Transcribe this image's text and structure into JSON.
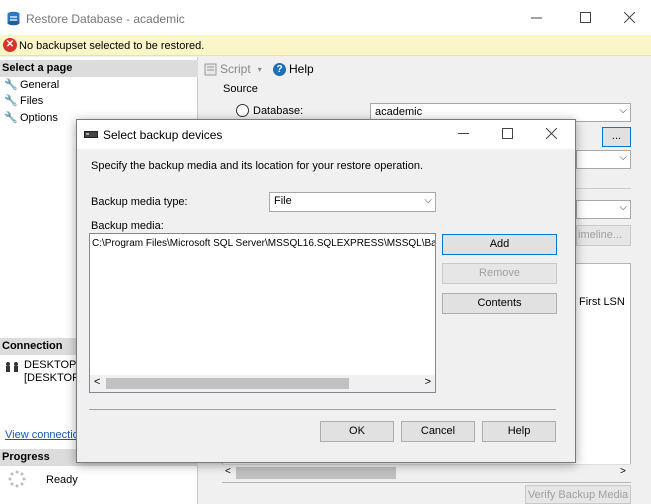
{
  "window": {
    "title": "Restore Database - academic"
  },
  "error": {
    "message": "No backupset selected to be restored."
  },
  "left": {
    "select_page_header": "Select a page",
    "pages": [
      {
        "label": "General",
        "icon": "wrench-icon"
      },
      {
        "label": "Files",
        "icon": "wrench-icon"
      },
      {
        "label": "Options",
        "icon": "wrench-icon"
      }
    ],
    "connection_header": "Connection",
    "connection_line1": "DESKTOP-",
    "connection_line2": "[DESKTOP",
    "view_connection_link": "View connection",
    "progress_header": "Progress",
    "progress_status": "Ready"
  },
  "toolbar": {
    "script_label": "Script",
    "help_label": "Help"
  },
  "source": {
    "label": "Source",
    "database_label": "Database:",
    "database_value": "academic",
    "browse_label": "...",
    "timeline_label": "imeline...",
    "first_lsn_header": "First LSN",
    "verify_button": "Verify Backup Media"
  },
  "dialog": {
    "title": "Select backup devices",
    "instruction": "Specify the backup media and its location for your restore operation.",
    "media_type_label": "Backup media type:",
    "media_type_value": "File",
    "media_label": "Backup media:",
    "media_items": [
      "C:\\Program Files\\Microsoft SQL Server\\MSSQL16.SQLEXPRESS\\MSSQL\\Ba"
    ],
    "add_label": "Add",
    "remove_label": "Remove",
    "contents_label": "Contents",
    "ok_label": "OK",
    "cancel_label": "Cancel",
    "help_label": "Help"
  }
}
